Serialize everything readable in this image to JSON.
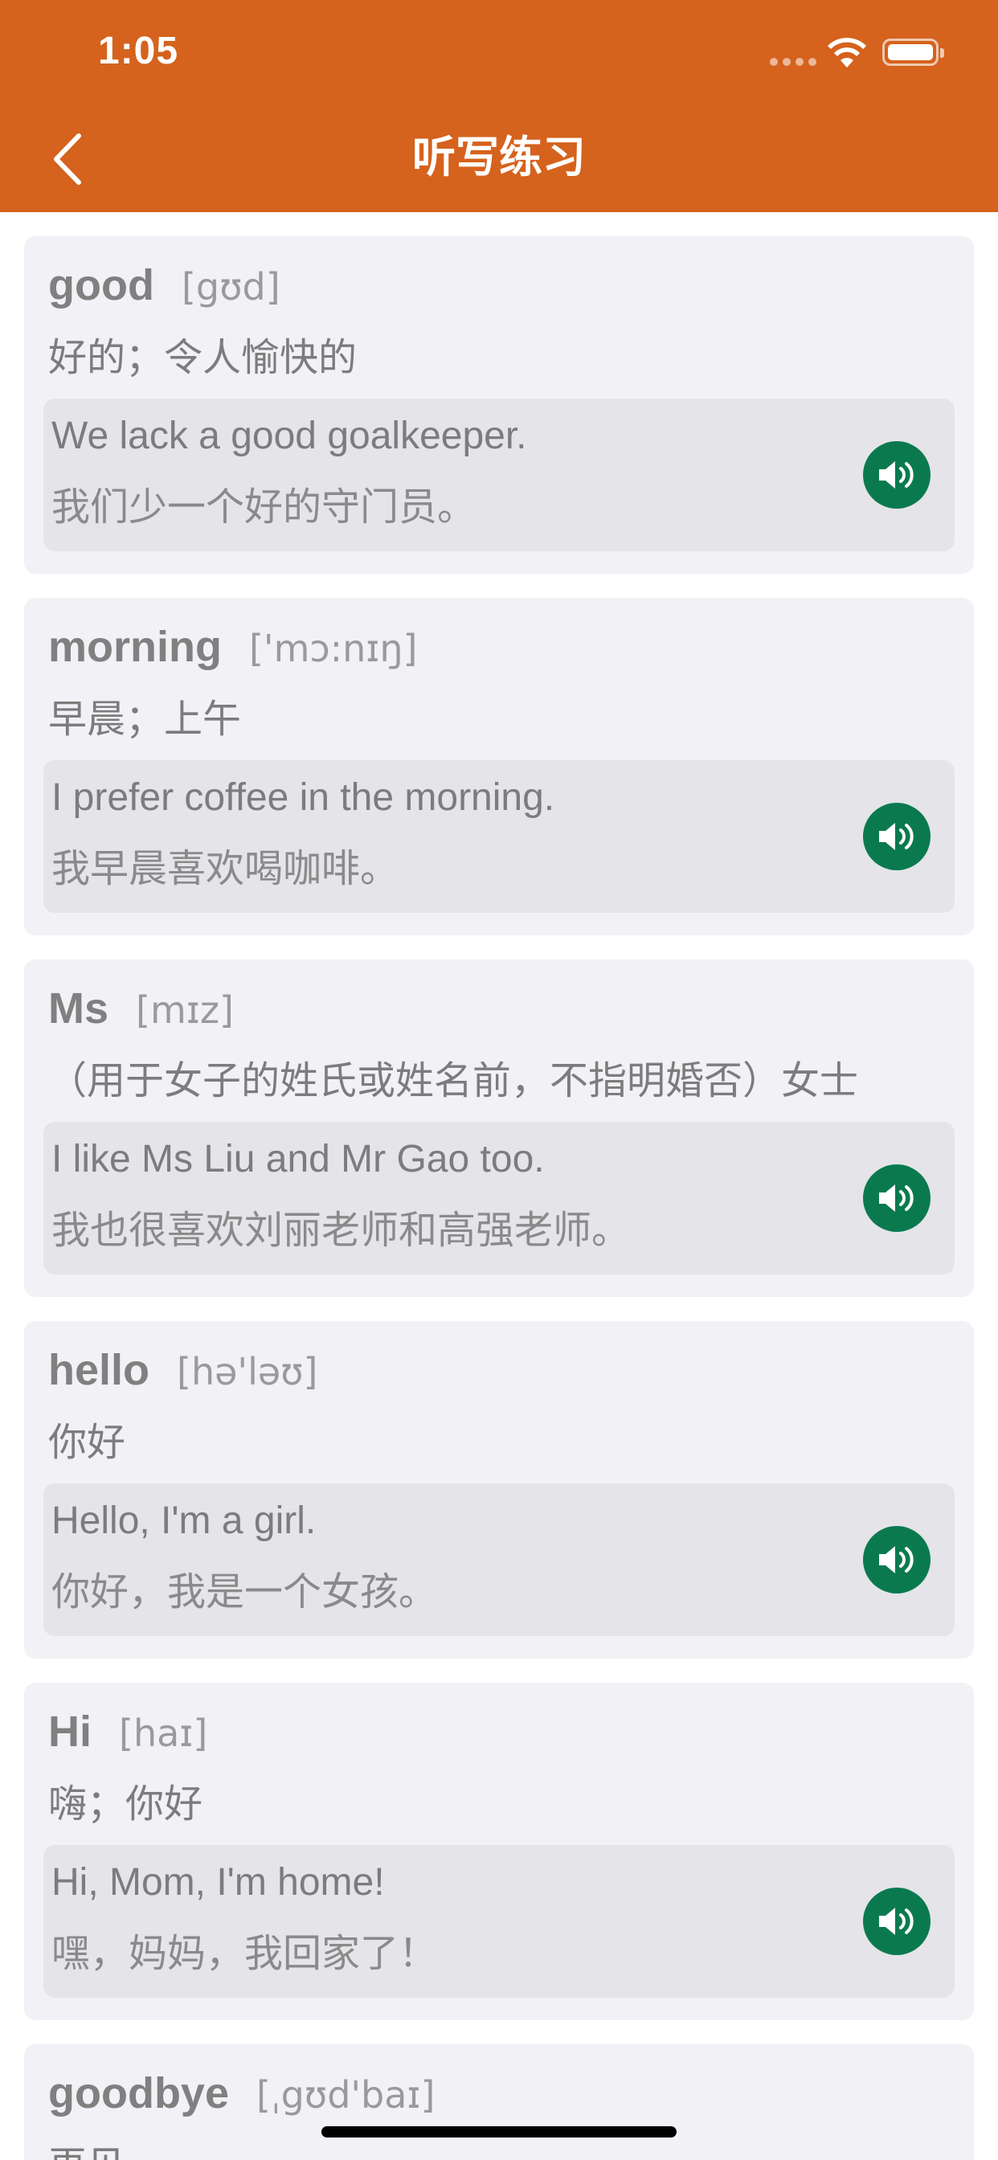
{
  "status_bar": {
    "time": "1:05"
  },
  "nav": {
    "title": "听写练习",
    "back_icon": "chevron-left-icon"
  },
  "colors": {
    "header": "#D5621D",
    "card_bg": "#F1F1F6",
    "example_bg": "#E4E4E9",
    "speaker": "#0A7A4E"
  },
  "words": [
    {
      "word": "good",
      "phonetic": "[gʊd]",
      "meaning": "好的；令人愉快的",
      "example_en": "We lack a good goalkeeper.",
      "example_zh": "我们少一个好的守门员。"
    },
    {
      "word": "morning",
      "phonetic": "['mɔ:nɪŋ]",
      "meaning": "早晨；上午",
      "example_en": "I prefer coffee in the morning.",
      "example_zh": "我早晨喜欢喝咖啡。"
    },
    {
      "word": "Ms",
      "phonetic": "[mɪz]",
      "meaning": "（用于女子的姓氏或姓名前，不指明婚否）女士",
      "example_en": "I like Ms Liu and Mr Gao too.",
      "example_zh": "我也很喜欢刘丽老师和高强老师。"
    },
    {
      "word": "hello",
      "phonetic": "[hə'ləʊ]",
      "meaning": "你好",
      "example_en": "Hello, I'm a girl.",
      "example_zh": "你好，我是一个女孩。"
    },
    {
      "word": "Hi",
      "phonetic": "[haɪ]",
      "meaning": "嗨；你好",
      "example_en": "Hi, Mom, I'm home!",
      "example_zh": "嘿，妈妈，我回家了！"
    },
    {
      "word": "goodbye",
      "phonetic": "[ˌgʊd'baɪ]",
      "meaning": "再见"
    }
  ]
}
